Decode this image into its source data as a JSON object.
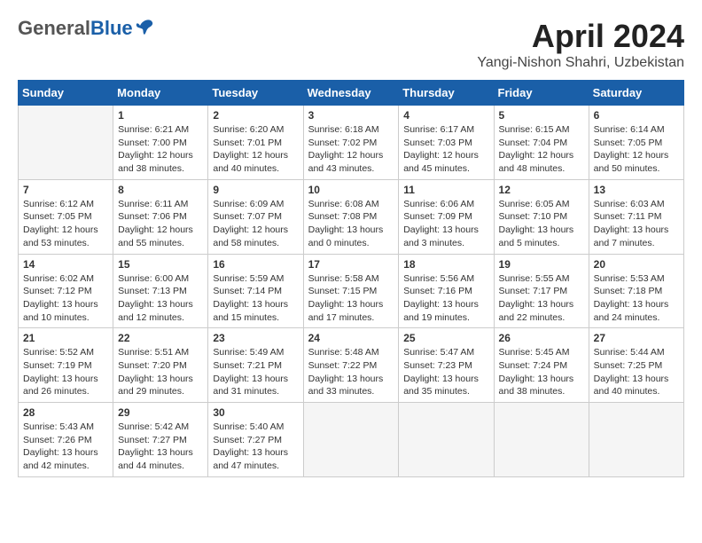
{
  "header": {
    "logo_general": "General",
    "logo_blue": "Blue",
    "title": "April 2024",
    "location": "Yangi-Nishon Shahri, Uzbekistan"
  },
  "weekdays": [
    "Sunday",
    "Monday",
    "Tuesday",
    "Wednesday",
    "Thursday",
    "Friday",
    "Saturday"
  ],
  "weeks": [
    [
      {
        "day": "",
        "info": ""
      },
      {
        "day": "1",
        "info": "Sunrise: 6:21 AM\nSunset: 7:00 PM\nDaylight: 12 hours\nand 38 minutes."
      },
      {
        "day": "2",
        "info": "Sunrise: 6:20 AM\nSunset: 7:01 PM\nDaylight: 12 hours\nand 40 minutes."
      },
      {
        "day": "3",
        "info": "Sunrise: 6:18 AM\nSunset: 7:02 PM\nDaylight: 12 hours\nand 43 minutes."
      },
      {
        "day": "4",
        "info": "Sunrise: 6:17 AM\nSunset: 7:03 PM\nDaylight: 12 hours\nand 45 minutes."
      },
      {
        "day": "5",
        "info": "Sunrise: 6:15 AM\nSunset: 7:04 PM\nDaylight: 12 hours\nand 48 minutes."
      },
      {
        "day": "6",
        "info": "Sunrise: 6:14 AM\nSunset: 7:05 PM\nDaylight: 12 hours\nand 50 minutes."
      }
    ],
    [
      {
        "day": "7",
        "info": "Sunrise: 6:12 AM\nSunset: 7:05 PM\nDaylight: 12 hours\nand 53 minutes."
      },
      {
        "day": "8",
        "info": "Sunrise: 6:11 AM\nSunset: 7:06 PM\nDaylight: 12 hours\nand 55 minutes."
      },
      {
        "day": "9",
        "info": "Sunrise: 6:09 AM\nSunset: 7:07 PM\nDaylight: 12 hours\nand 58 minutes."
      },
      {
        "day": "10",
        "info": "Sunrise: 6:08 AM\nSunset: 7:08 PM\nDaylight: 13 hours\nand 0 minutes."
      },
      {
        "day": "11",
        "info": "Sunrise: 6:06 AM\nSunset: 7:09 PM\nDaylight: 13 hours\nand 3 minutes."
      },
      {
        "day": "12",
        "info": "Sunrise: 6:05 AM\nSunset: 7:10 PM\nDaylight: 13 hours\nand 5 minutes."
      },
      {
        "day": "13",
        "info": "Sunrise: 6:03 AM\nSunset: 7:11 PM\nDaylight: 13 hours\nand 7 minutes."
      }
    ],
    [
      {
        "day": "14",
        "info": "Sunrise: 6:02 AM\nSunset: 7:12 PM\nDaylight: 13 hours\nand 10 minutes."
      },
      {
        "day": "15",
        "info": "Sunrise: 6:00 AM\nSunset: 7:13 PM\nDaylight: 13 hours\nand 12 minutes."
      },
      {
        "day": "16",
        "info": "Sunrise: 5:59 AM\nSunset: 7:14 PM\nDaylight: 13 hours\nand 15 minutes."
      },
      {
        "day": "17",
        "info": "Sunrise: 5:58 AM\nSunset: 7:15 PM\nDaylight: 13 hours\nand 17 minutes."
      },
      {
        "day": "18",
        "info": "Sunrise: 5:56 AM\nSunset: 7:16 PM\nDaylight: 13 hours\nand 19 minutes."
      },
      {
        "day": "19",
        "info": "Sunrise: 5:55 AM\nSunset: 7:17 PM\nDaylight: 13 hours\nand 22 minutes."
      },
      {
        "day": "20",
        "info": "Sunrise: 5:53 AM\nSunset: 7:18 PM\nDaylight: 13 hours\nand 24 minutes."
      }
    ],
    [
      {
        "day": "21",
        "info": "Sunrise: 5:52 AM\nSunset: 7:19 PM\nDaylight: 13 hours\nand 26 minutes."
      },
      {
        "day": "22",
        "info": "Sunrise: 5:51 AM\nSunset: 7:20 PM\nDaylight: 13 hours\nand 29 minutes."
      },
      {
        "day": "23",
        "info": "Sunrise: 5:49 AM\nSunset: 7:21 PM\nDaylight: 13 hours\nand 31 minutes."
      },
      {
        "day": "24",
        "info": "Sunrise: 5:48 AM\nSunset: 7:22 PM\nDaylight: 13 hours\nand 33 minutes."
      },
      {
        "day": "25",
        "info": "Sunrise: 5:47 AM\nSunset: 7:23 PM\nDaylight: 13 hours\nand 35 minutes."
      },
      {
        "day": "26",
        "info": "Sunrise: 5:45 AM\nSunset: 7:24 PM\nDaylight: 13 hours\nand 38 minutes."
      },
      {
        "day": "27",
        "info": "Sunrise: 5:44 AM\nSunset: 7:25 PM\nDaylight: 13 hours\nand 40 minutes."
      }
    ],
    [
      {
        "day": "28",
        "info": "Sunrise: 5:43 AM\nSunset: 7:26 PM\nDaylight: 13 hours\nand 42 minutes."
      },
      {
        "day": "29",
        "info": "Sunrise: 5:42 AM\nSunset: 7:27 PM\nDaylight: 13 hours\nand 44 minutes."
      },
      {
        "day": "30",
        "info": "Sunrise: 5:40 AM\nSunset: 7:27 PM\nDaylight: 13 hours\nand 47 minutes."
      },
      {
        "day": "",
        "info": ""
      },
      {
        "day": "",
        "info": ""
      },
      {
        "day": "",
        "info": ""
      },
      {
        "day": "",
        "info": ""
      }
    ]
  ]
}
